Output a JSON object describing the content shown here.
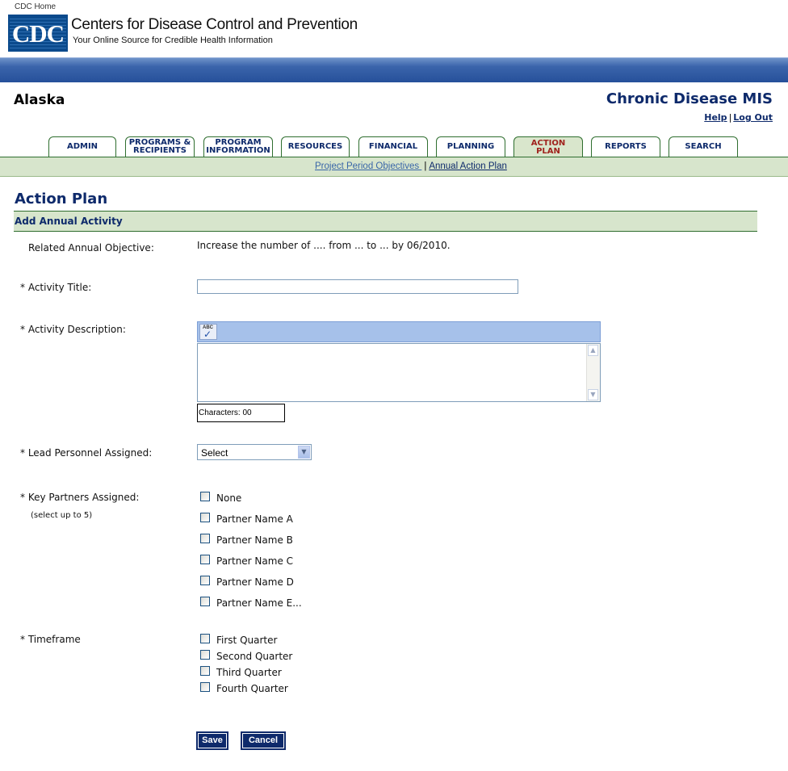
{
  "header": {
    "home_link": "CDC Home",
    "logo_text": "CDC",
    "org_name": "Centers for Disease Control and Prevention",
    "tagline": "Your Online Source for Credible Health Information",
    "state": "Alaska",
    "app_title": "Chronic Disease MIS",
    "help": "Help",
    "separator": "|",
    "logout": "Log Out"
  },
  "tabs": [
    {
      "label": "ADMIN"
    },
    {
      "label": "PROGRAMS &\nRECIPIENTS"
    },
    {
      "label": "PROGRAM\nINFORMATION"
    },
    {
      "label": "RESOURCES"
    },
    {
      "label": "FINANCIAL"
    },
    {
      "label": "PLANNING"
    },
    {
      "label": "ACTION\nPLAN",
      "active": true
    },
    {
      "label": "REPORTS"
    },
    {
      "label": "SEARCH"
    }
  ],
  "subnav": {
    "link1": "Project Period Objectives ",
    "separator": "|",
    "link2": "Annual Action Plan"
  },
  "page": {
    "title": "Action Plan",
    "section": "Add Annual Activity"
  },
  "form": {
    "objective_label": "Related Annual Objective:",
    "objective_value": "Increase the number of .... from ... to ... by 06/2010.",
    "title_label": "* Activity Title:",
    "title_value": "",
    "description_label": "* Activity Description:",
    "spell_abc": "ABC",
    "spell_icon": "spellcheck-icon",
    "char_count": "Characters: 00",
    "lead_label": "* Lead Personnel Assigned:",
    "lead_value": "Select",
    "partners_label": "* Key Partners Assigned:",
    "partners_hint": "(select up to 5)",
    "partners": [
      "None",
      "Partner Name A",
      "Partner Name B",
      "Partner Name C",
      "Partner Name D",
      "Partner Name E..."
    ],
    "timeframe_label": "* Timeframe",
    "timeframes": [
      "First Quarter",
      "Second Quarter",
      "Third Quarter",
      "Fourth Quarter"
    ],
    "save": "Save",
    "cancel": "Cancel"
  },
  "colors": {
    "navy": "#0e2a6b",
    "active_tab_text": "#a0231d",
    "green_band": "#d7e5cc",
    "blue_band": "#26509a"
  }
}
